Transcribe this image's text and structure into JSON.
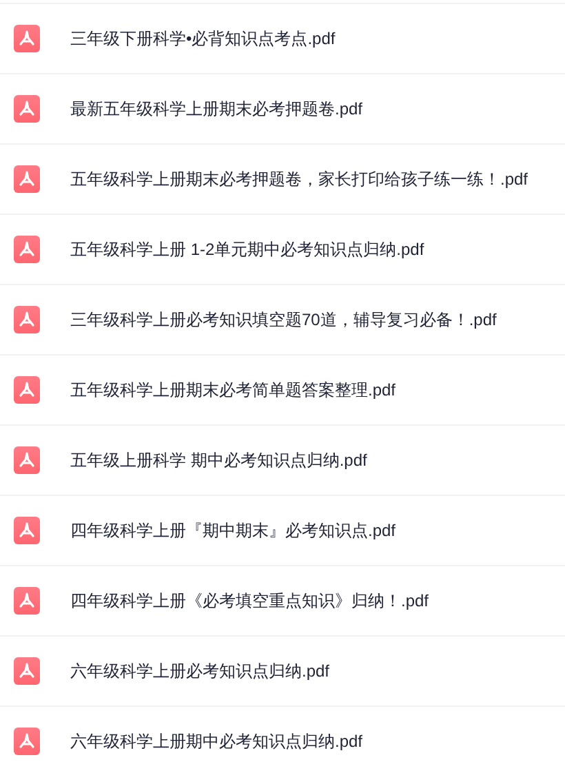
{
  "files": [
    {
      "name": "三年级下册科学•必背知识点考点.pdf"
    },
    {
      "name": "最新五年级科学上册期末必考押题卷.pdf"
    },
    {
      "name": "五年级科学上册期末必考押题卷，家长打印给孩子练一练！.pdf"
    },
    {
      "name": "五年级科学上册 1-2单元期中必考知识点归纳.pdf"
    },
    {
      "name": "三年级科学上册必考知识填空题70道，辅导复习必备！.pdf"
    },
    {
      "name": "五年级科学上册期末必考简单题答案整理.pdf"
    },
    {
      "name": "五年级上册科学 期中必考知识点归纳.pdf"
    },
    {
      "name": "四年级科学上册『期中期末』必考知识点.pdf"
    },
    {
      "name": "四年级科学上册《必考填空重点知识》归纳！.pdf"
    },
    {
      "name": "六年级科学上册必考知识点归纳.pdf"
    },
    {
      "name": "六年级科学上册期中必考知识点归纳.pdf"
    }
  ]
}
